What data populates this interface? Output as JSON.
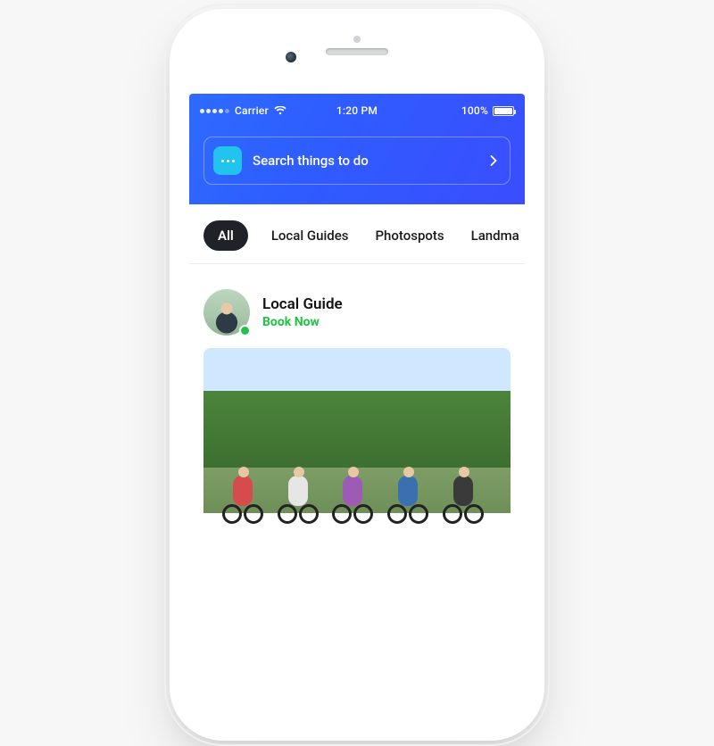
{
  "status_bar": {
    "carrier": "Carrier",
    "time": "1:20 PM",
    "battery_pct": "100%"
  },
  "search": {
    "placeholder": "Search things to do"
  },
  "tabs": [
    {
      "label": "All",
      "active": true
    },
    {
      "label": "Local Guides",
      "active": false
    },
    {
      "label": "Photospots",
      "active": false
    },
    {
      "label": "Landma",
      "active": false
    }
  ],
  "card": {
    "title": "Local Guide",
    "cta": "Book Now",
    "presence_color": "#23c145"
  }
}
